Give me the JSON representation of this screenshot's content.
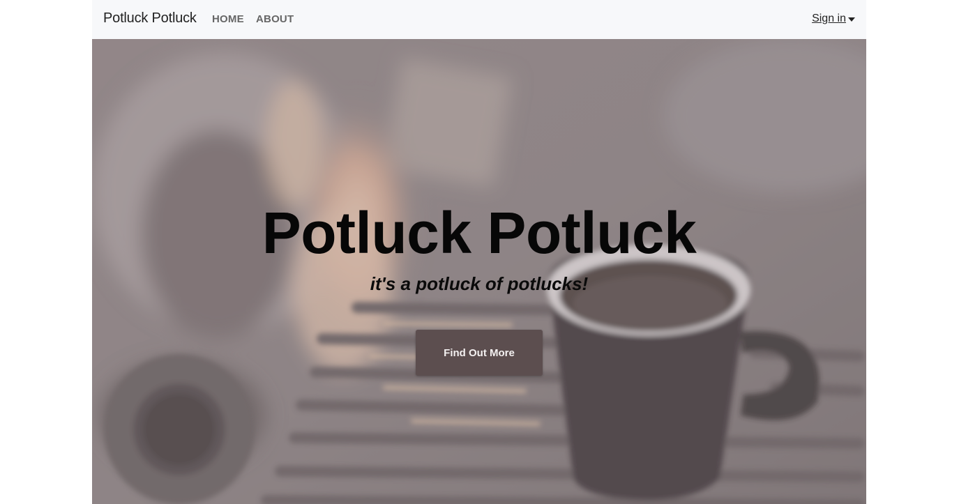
{
  "navbar": {
    "brand": "Potluck Potluck",
    "links": [
      "HOME",
      "ABOUT"
    ],
    "signin_label": "Sign in"
  },
  "hero": {
    "title": "Potluck Potluck",
    "tagline": "it's a potluck of potlucks!",
    "cta_label": "Find Out More"
  },
  "colors": {
    "navbar_bg": "#f7f8fa",
    "cta_bg": "#5c4e4f",
    "overlay": "#a09698"
  },
  "icons": {
    "signin_dropdown": "caret-down-icon"
  }
}
